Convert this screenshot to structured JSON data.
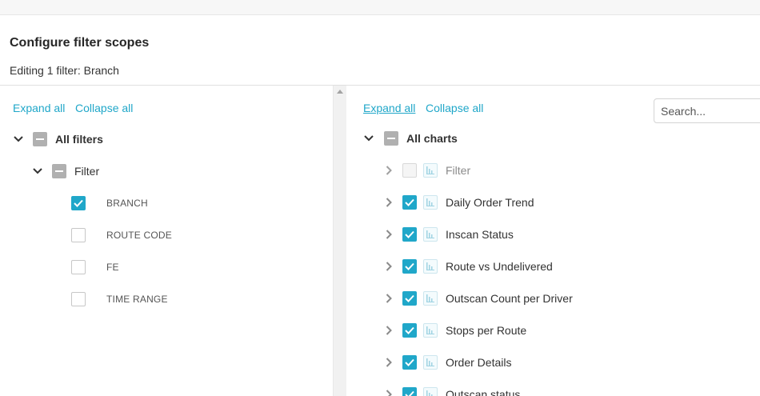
{
  "modal": {
    "title": "Configure filter scopes",
    "subtitle": "Editing 1 filter: Branch"
  },
  "left": {
    "expand_all": "Expand all",
    "collapse_all": "Collapse all",
    "root_label": "All filters",
    "group_label": "Filter",
    "filters": [
      {
        "label": "BRANCH",
        "checked": true
      },
      {
        "label": "ROUTE CODE",
        "checked": false
      },
      {
        "label": "FE",
        "checked": false
      },
      {
        "label": "TIME RANGE",
        "checked": false
      }
    ]
  },
  "right": {
    "expand_all": "Expand all",
    "collapse_all": "Collapse all",
    "search_placeholder": "Search...",
    "root_label": "All charts",
    "charts": [
      {
        "label": "Filter",
        "checked": false,
        "disabled": true
      },
      {
        "label": "Daily Order Trend",
        "checked": true
      },
      {
        "label": "Inscan Status",
        "checked": true
      },
      {
        "label": "Route vs Undelivered",
        "checked": true
      },
      {
        "label": "Outscan Count per Driver",
        "checked": true
      },
      {
        "label": "Stops per Route",
        "checked": true
      },
      {
        "label": "Order Details",
        "checked": true
      },
      {
        "label": "Outscan status",
        "checked": true
      }
    ]
  },
  "colors": {
    "accent": "#20a7c9",
    "partial": "#b0b0b0"
  },
  "icons": {
    "expand": "chevron-down-icon",
    "collapsed": "chevron-right-icon",
    "check": "check-icon",
    "chart": "bar-chart-icon"
  }
}
